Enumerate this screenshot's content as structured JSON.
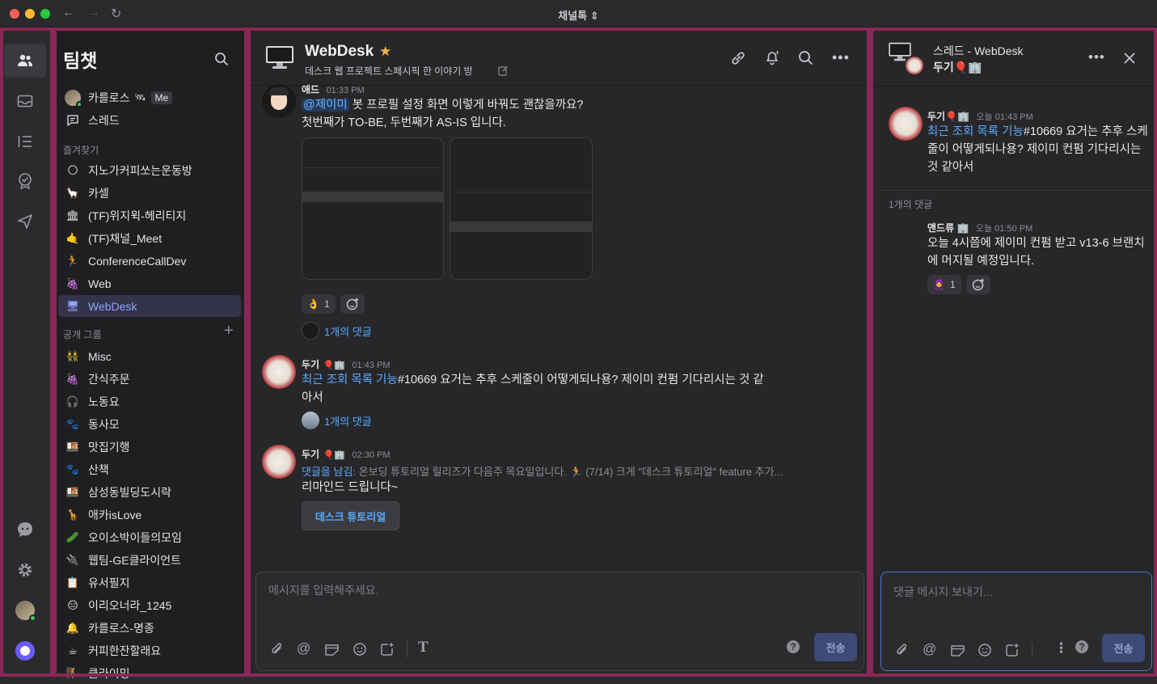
{
  "window": {
    "title": "채널톡 ⇕"
  },
  "sidebar": {
    "title": "팀챗",
    "top_items": [
      {
        "label": "카를로스",
        "icon": "avatar",
        "badge": "Me"
      },
      {
        "label": "스레드",
        "icon": "thread-icon"
      }
    ],
    "favorites_label": "즐겨찾기",
    "favorites": [
      {
        "label": "지노가커피쏘는운동방",
        "icon": "🌕"
      },
      {
        "label": "카셀",
        "icon": "🦙"
      },
      {
        "label": "(TF)위지윅-헤리티지",
        "icon": "🏛"
      },
      {
        "label": "(TF)채널_Meet",
        "icon": "🤙"
      },
      {
        "label": "ConferenceCallDev",
        "icon": "🏃"
      },
      {
        "label": "Web",
        "icon": "🍇"
      },
      {
        "label": "WebDesk",
        "icon": "🖥",
        "active": true
      }
    ],
    "public_label": "공개 그룹",
    "public_groups": [
      {
        "label": "Misc",
        "icon": "👯"
      },
      {
        "label": "간식주문",
        "icon": "🍇"
      },
      {
        "label": "노동요",
        "icon": "🎧"
      },
      {
        "label": "동사모",
        "icon": "🐾"
      },
      {
        "label": "맛집기행",
        "icon": "🍱"
      },
      {
        "label": "산책",
        "icon": "🐾"
      },
      {
        "label": "삼성동빌딩도시락",
        "icon": "🍱"
      },
      {
        "label": "애카isLove",
        "icon": "🦒"
      },
      {
        "label": "오이소박이들의모임",
        "icon": "🥒"
      },
      {
        "label": "웹팀-GE클라이언트",
        "icon": "🔌"
      },
      {
        "label": "유서필지",
        "icon": "📋"
      },
      {
        "label": "이리오너라_1245",
        "icon": "😑"
      },
      {
        "label": "카를로스-명종",
        "icon": "🔔"
      },
      {
        "label": "커피한잔할래요",
        "icon": "☕"
      },
      {
        "label": "클라이밍",
        "icon": "🧗"
      }
    ]
  },
  "channel": {
    "name": "WebDesk",
    "description": "데스크 웹 프로젝트 스페시픽 한 이야기 방",
    "star": "★"
  },
  "messages": [
    {
      "author": "애드",
      "time": "01:33 PM",
      "mention": "@제이미",
      "text1": " 봇 프로필 설정 화면 이렇게 바꿔도 괜찮을까요?",
      "text2": "첫번째가 TO-BE, 두번째가 AS-IS 입니다.",
      "reaction_emoji": "👌",
      "reaction_count": "1",
      "replies": "1개의 댓글"
    },
    {
      "author": "두기",
      "time": "01:43 PM",
      "link": "최근 조회 목록 기능",
      "text1": "#10669 요거는 추후 스케줄이 어떻게되나용? 제이미 컨펌 기다리시는 것 같",
      "text2": "아서",
      "replies": "1개의 댓글"
    },
    {
      "author": "두기",
      "time": "02:30 PM",
      "quote_label": "댓글을 남김:",
      "quote_text": " 온보딩 튜토리얼 릴리즈가 다음주 목요일입니다. 🏃 (7/14) 크게 \"데스크 튜토리얼\" feature 추가...",
      "text1": "리마인드 드립니다~",
      "button": "데스크 튜토리얼"
    }
  ],
  "composer": {
    "placeholder": "메시지를 입력해주세요.",
    "send": "전송",
    "help": "?"
  },
  "thread": {
    "title": "스레드 - WebDesk",
    "subtitle": "두기🎈🏢",
    "root": {
      "author": "두기🎈🏢",
      "time": "오늘 01:43 PM",
      "link": "최근 조회 목록 기능",
      "text": "#10669 요거는 추후 스케줄이 어떻게되나용? 제이미 컨펌 기다리시는 것 같아서"
    },
    "comment_count": "1개의 댓글",
    "reply": {
      "author": "앤드류 🏢",
      "time": "오늘 01:50 PM",
      "text": "오늘 4시쯤에 제이미 컨펌 받고 v13-6 브랜치에 머지될 예정입니다.",
      "reaction_emoji": "🧕",
      "reaction_count": "1"
    },
    "composer_placeholder": "댓글 메시지 보내기...",
    "send": "전송",
    "help": "?"
  }
}
